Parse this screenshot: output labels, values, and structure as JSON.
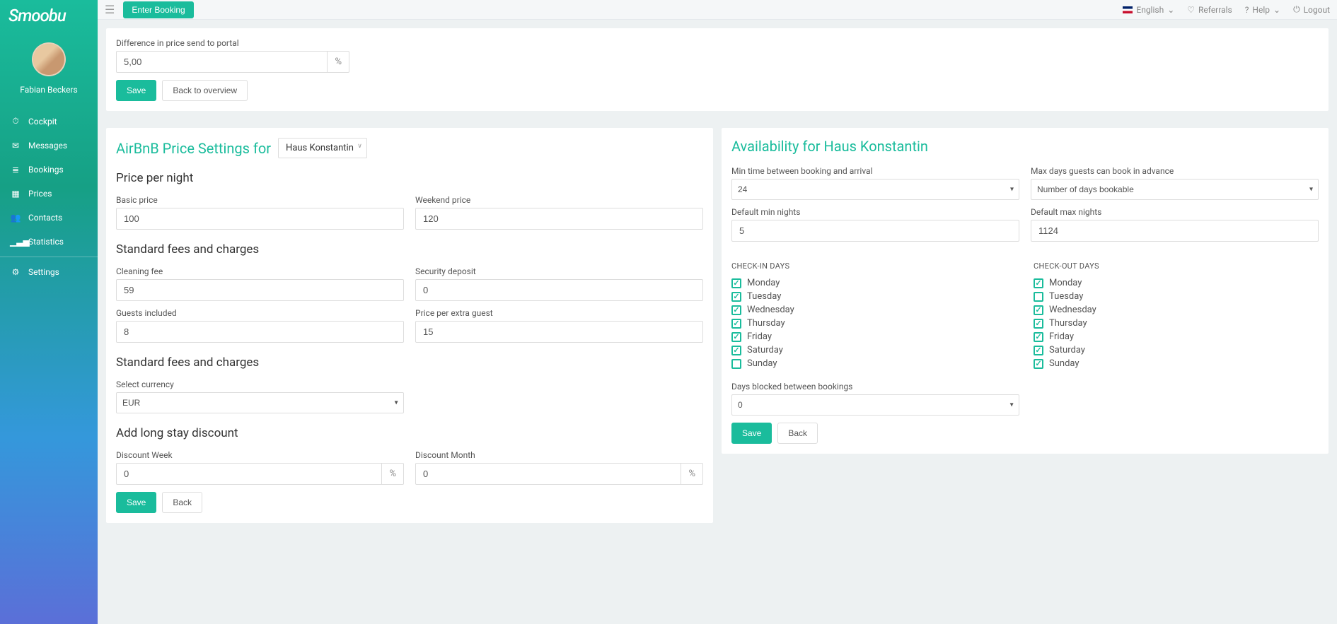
{
  "brand": "Smoobu",
  "user": {
    "name": "Fabian Beckers"
  },
  "topbar": {
    "enter_booking": "Enter Booking",
    "language": "English",
    "referrals": "Referrals",
    "help": "Help",
    "logout": "Logout"
  },
  "nav": [
    {
      "icon": "⏱",
      "label": "Cockpit",
      "name": "nav-cockpit"
    },
    {
      "icon": "✉",
      "label": "Messages",
      "name": "nav-messages"
    },
    {
      "icon": "≣",
      "label": "Bookings",
      "name": "nav-bookings"
    },
    {
      "icon": "▦",
      "label": "Prices",
      "name": "nav-prices"
    },
    {
      "icon": "👥",
      "label": "Contacts",
      "name": "nav-contacts"
    },
    {
      "icon": "▁▃▅",
      "label": "Statistics",
      "name": "nav-statistics"
    },
    {
      "icon": "⚙",
      "label": "Settings",
      "name": "nav-settings"
    }
  ],
  "top_panel": {
    "diff_label": "Difference in price send to portal",
    "diff_value": "5,00",
    "diff_unit": "%",
    "save": "Save",
    "back": "Back to overview"
  },
  "price_panel": {
    "title": "AirBnB Price Settings for",
    "property": "Haus Konstantin",
    "sub_price_per_night": "Price per night",
    "basic_price_label": "Basic price",
    "basic_price": "100",
    "weekend_price_label": "Weekend price",
    "weekend_price": "120",
    "sub_fees": "Standard fees and charges",
    "cleaning_fee_label": "Cleaning fee",
    "cleaning_fee": "59",
    "security_deposit_label": "Security deposit",
    "security_deposit": "0",
    "guests_included_label": "Guests included",
    "guests_included": "8",
    "price_per_extra_label": "Price per extra guest",
    "price_per_extra": "15",
    "sub_fees2": "Standard fees and charges",
    "currency_label": "Select currency",
    "currency": "EUR",
    "sub_discount": "Add long stay discount",
    "discount_week_label": "Discount Week",
    "discount_week": "0",
    "discount_month_label": "Discount Month",
    "discount_month": "0",
    "percent": "%",
    "save": "Save",
    "back": "Back"
  },
  "avail_panel": {
    "title": "Availability for Haus Konstantin",
    "min_time_label": "Min time between booking and arrival",
    "min_time": "24",
    "max_days_label": "Max days guests can book in advance",
    "max_days": "Number of days bookable",
    "default_min_label": "Default min nights",
    "default_min": "5",
    "default_max_label": "Default max nights",
    "default_max": "1124",
    "checkin_heading": "CHECK-IN DAYS",
    "checkout_heading": "CHECK-OUT DAYS",
    "days": [
      "Monday",
      "Tuesday",
      "Wednesday",
      "Thursday",
      "Friday",
      "Saturday",
      "Sunday"
    ],
    "checkin": [
      true,
      true,
      true,
      true,
      true,
      true,
      false
    ],
    "checkout": [
      true,
      false,
      true,
      true,
      true,
      true,
      true
    ],
    "blocked_label": "Days blocked between bookings",
    "blocked": "0",
    "save": "Save",
    "back": "Back"
  }
}
